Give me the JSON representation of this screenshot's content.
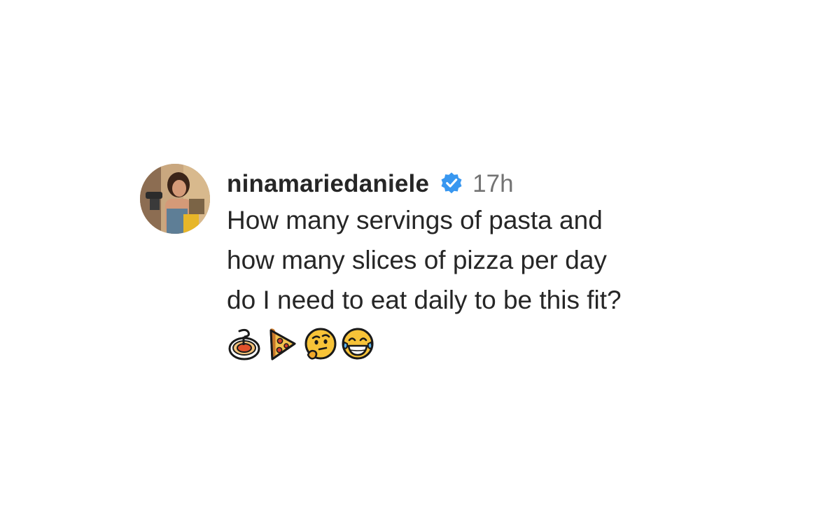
{
  "comment": {
    "username": "ninamariedaniele",
    "verified_icon": "verified-badge-icon",
    "timestamp": "17h",
    "text_lines": [
      "How many servings of pasta and",
      "how many slices of pizza per day",
      "do I need to eat daily to be this fit?"
    ],
    "emojis": [
      "spaghetti-icon",
      "pizza-icon",
      "thinking-face-icon",
      "tears-of-joy-icon"
    ],
    "colors": {
      "verified_blue": "#3897f0",
      "timestamp_gray": "#737373",
      "text": "#262626"
    }
  }
}
